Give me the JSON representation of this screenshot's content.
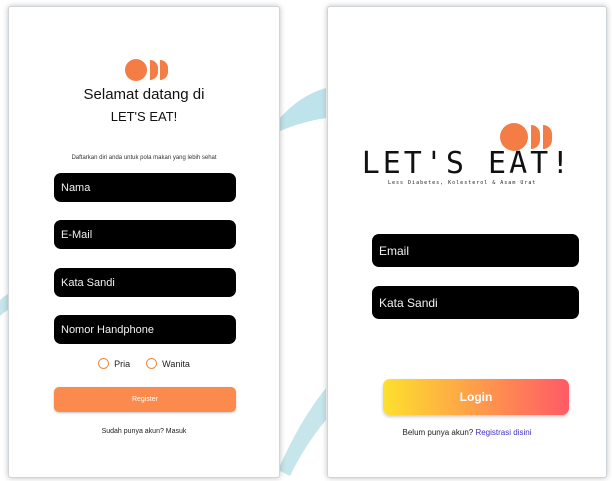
{
  "colors": {
    "brand_orange": "#f47c45",
    "field_bg": "#000000",
    "register_button": "#fb8a4c",
    "login_gradient_start": "#fde02d",
    "login_gradient_end": "#ff5a67",
    "link": "#3b2fc7",
    "background_accent": "#bfe3ea"
  },
  "icons": {
    "logo": "logo-dots-icon",
    "radio": "radio-circle-icon"
  },
  "register": {
    "welcome_line1": "Selamat datang di",
    "welcome_line2": "LET'S EAT!",
    "subtitle": "Daftarkan diri anda untuk pola makan yang lebih sehat",
    "fields": [
      {
        "key": "name",
        "placeholder": "Nama"
      },
      {
        "key": "email",
        "placeholder": "E-Mail"
      },
      {
        "key": "password",
        "placeholder": "Kata Sandi"
      },
      {
        "key": "phone",
        "placeholder": "Nomor Handphone"
      }
    ],
    "gender_options": [
      "Pria",
      "Wanita"
    ],
    "register_button": "Register",
    "footer_text": "Sudah punya akun? Masuk"
  },
  "login": {
    "brand": "LET'S EAT!",
    "tagline": "Less Diabetes, Kolesterol & Asam Urat",
    "fields": [
      {
        "key": "email",
        "placeholder": "Email"
      },
      {
        "key": "password",
        "placeholder": "Kata Sandi"
      }
    ],
    "login_button": "Login",
    "footer_prompt": "Belum punya akun?",
    "footer_link": "Registrasi disini"
  }
}
